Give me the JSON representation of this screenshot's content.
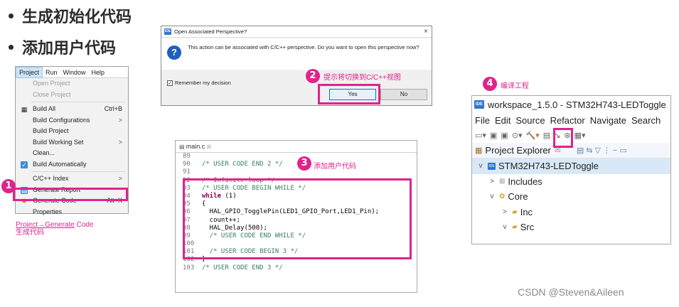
{
  "bullets": [
    "生成初始化代码",
    "添加用户代码"
  ],
  "menu": {
    "menubar": [
      "Project",
      "Run",
      "Window",
      "Help"
    ],
    "items": [
      {
        "label": "Open Project",
        "disabled": true
      },
      {
        "label": "Close Project",
        "disabled": true
      },
      {
        "label": "Build All",
        "shortcut": "Ctrl+B"
      },
      {
        "label": "Build Configurations",
        "arrow": ">"
      },
      {
        "label": "Build Project"
      },
      {
        "label": "Build Working Set",
        "arrow": ">"
      },
      {
        "label": "Clean..."
      },
      {
        "label": "Build Automatically",
        "checked": true
      },
      {
        "label": "C/C++ Index",
        "arrow": ">"
      },
      {
        "label": "Generate Report"
      },
      {
        "label": "Generate Code",
        "shortcut": "Alt+K"
      },
      {
        "label": "Properties"
      }
    ],
    "caption_line1_a": "Project",
    "caption_line1_arrow": "→",
    "caption_line1_b": "Generate",
    "caption_line1_c": " Code",
    "caption_line2": "生成代码"
  },
  "steps": {
    "s1": "1",
    "s2": "2",
    "s3": "3",
    "s4": "4",
    "s2_label": "提示将切换到C/C++视图",
    "s3_label": "添加用户代码",
    "s4_label": "编译工程"
  },
  "dialog": {
    "title": "Open Associated Perspective?",
    "message": "This action can be associated with C/C++ perspective. Do you want to open this perspective now?",
    "remember": "Remember my decision",
    "yes": "Yes",
    "no": "No",
    "close": "×",
    "badge": "IDE"
  },
  "editor": {
    "tab": "main.c",
    "tab_close": "☒",
    "lines": [
      {
        "n": "89",
        "segments": []
      },
      {
        "n": "90",
        "segments": [
          {
            "c": "cm",
            "t": "  /* USER CODE END 2 */"
          }
        ]
      },
      {
        "n": "91",
        "segments": []
      },
      {
        "n": "92",
        "segments": [
          {
            "c": "cm",
            "t": "  /* Infinite loop */"
          }
        ]
      },
      {
        "n": "93",
        "segments": [
          {
            "c": "cm",
            "t": "  /* USER CODE BEGIN WHILE */"
          }
        ]
      },
      {
        "n": "94",
        "segments": [
          {
            "c": "kw",
            "t": "  while"
          },
          {
            "c": "code",
            "t": " (1)"
          }
        ]
      },
      {
        "n": "95",
        "segments": [
          {
            "c": "code",
            "t": "  {"
          }
        ]
      },
      {
        "n": "96",
        "segments": [
          {
            "c": "code",
            "t": "    HAL_GPIO_TogglePin(LED1_GPIO_Port,LED1_Pin);"
          }
        ]
      },
      {
        "n": "97",
        "segments": [
          {
            "c": "code",
            "t": "    count++;"
          }
        ]
      },
      {
        "n": "98",
        "segments": [
          {
            "c": "code",
            "t": "    HAL_Delay(500);"
          }
        ]
      },
      {
        "n": "99",
        "segments": [
          {
            "c": "cm",
            "t": "    /* USER CODE END WHILE */"
          }
        ]
      },
      {
        "n": "100",
        "segments": []
      },
      {
        "n": "101",
        "segments": [
          {
            "c": "cm",
            "t": "    /* USER CODE BEGIN 3 */"
          }
        ]
      },
      {
        "n": "102",
        "segments": [
          {
            "c": "code",
            "t": "  }"
          }
        ]
      },
      {
        "n": "103",
        "segments": [
          {
            "c": "cm",
            "t": "  /* USER CODE END 3 */"
          }
        ]
      }
    ]
  },
  "ide": {
    "badge": "IDE",
    "title": "workspace_1.5.0 - STM32H743-LEDToggle",
    "menubar": [
      "File",
      "Edit",
      "Source",
      "Refactor",
      "Navigate",
      "Search"
    ],
    "panel_title": "Project Explorer",
    "project": "STM32H743-LEDToggle",
    "tree": [
      {
        "chev": ">",
        "label": "Includes",
        "indent": 1
      },
      {
        "chev": "v",
        "label": "Core",
        "indent": 1
      },
      {
        "chev": ">",
        "label": "Inc",
        "indent": 2
      },
      {
        "chev": "v",
        "label": "Src",
        "indent": 2
      }
    ]
  },
  "watermark": "CSDN @Steven&Aileen"
}
